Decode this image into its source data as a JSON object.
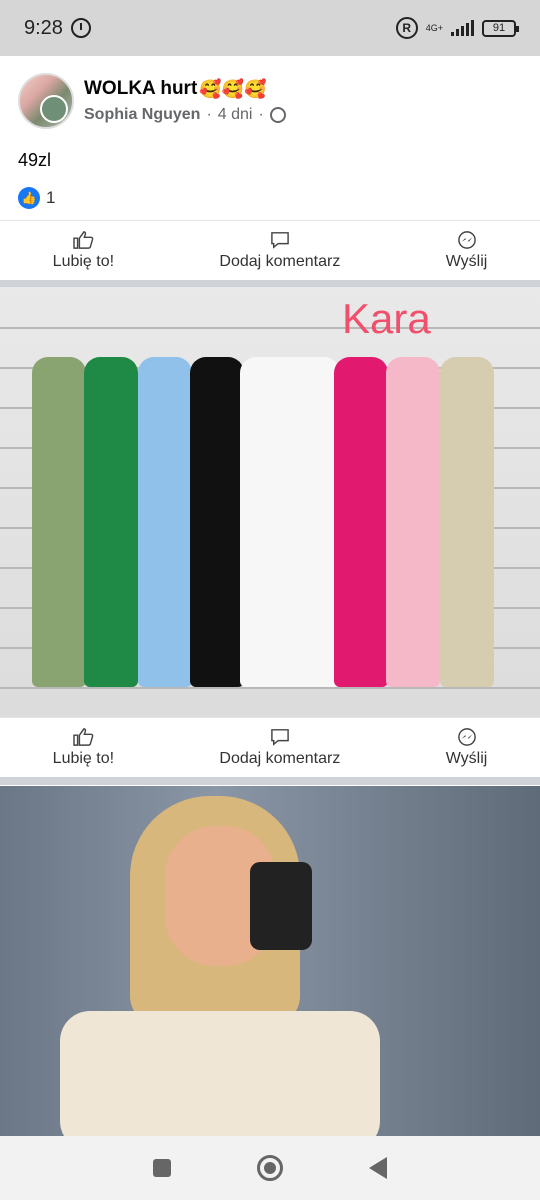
{
  "status_bar": {
    "time": "9:28",
    "network": "4G+",
    "battery": "91"
  },
  "post": {
    "group_name": "WOLKA hurt",
    "author": "Sophia Nguyen",
    "time_ago": "4 dni",
    "text": "49zl",
    "likes_count": "1"
  },
  "actions": {
    "like_label": "Lubię to!",
    "comment_label": "Dodaj komentarz",
    "send_label": "Wyślij"
  },
  "photo1": {
    "overlay_text": "Kara"
  },
  "colors": {
    "like_blue": "#1877f2",
    "kara_pink": "#f0506b"
  },
  "dresses": [
    {
      "color": "#8aa471"
    },
    {
      "color": "#1f8a45"
    },
    {
      "color": "#8fc1ea"
    },
    {
      "color": "#111111"
    },
    {
      "color": "#f7f7f7"
    },
    {
      "color": "#e1196f"
    },
    {
      "color": "#f4b8c9"
    },
    {
      "color": "#d6ccb0"
    }
  ]
}
